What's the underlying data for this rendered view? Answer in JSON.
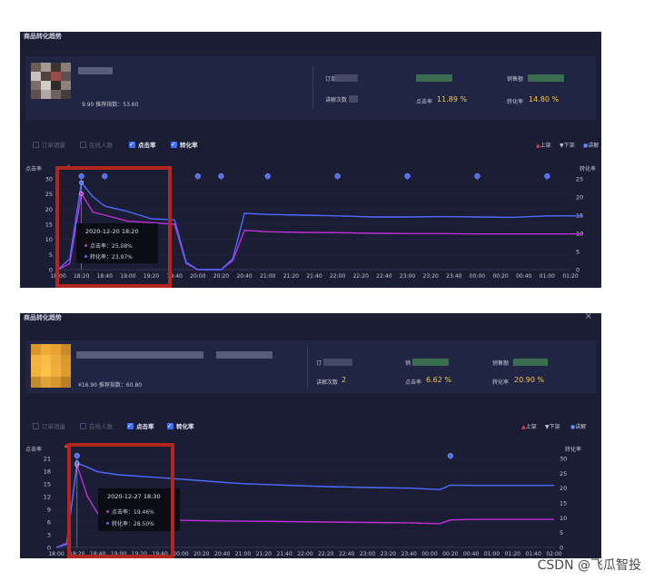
{
  "panel1": {
    "title": "商品转化趋势",
    "product": {
      "price_line": "9.90  推荐指数：53.60",
      "thumb_colors": [
        "#6b5b55",
        "#a89a92",
        "#3b3431",
        "#8b7d76",
        "#c9c0bb",
        "#4d4240",
        "#9b4b45",
        "#5b5150",
        "#7a6d69",
        "#d2cbc7",
        "#2f2a29",
        "#8e817c",
        "#5c504d",
        "#b0a7a2",
        "#6d625f",
        "#463d3b"
      ]
    },
    "stats": {
      "order_label": "订单",
      "explain_label": "讲解次数",
      "sales_label": "销售额",
      "click_label": "点击率",
      "click_value": "11.89 %",
      "conv_label": "转化率",
      "conv_value": "14.80 %"
    },
    "checkboxes": [
      {
        "label": "订单销量",
        "checked": false
      },
      {
        "label": "在线人数",
        "checked": false
      },
      {
        "label": "点击率",
        "checked": true
      },
      {
        "label": "转化率",
        "checked": true
      }
    ],
    "legend": {
      "up": "上架",
      "down": "下架",
      "explain": "讲解"
    },
    "left_axis_title": "点击率",
    "right_axis_title": "转化率",
    "tooltip": {
      "time": "2020-12-20 18:20",
      "click": "点击率：25.08%",
      "conv": "转化率：23.97%"
    }
  },
  "panel2": {
    "title": "商品转化趋势",
    "close": "×",
    "product": {
      "price_line": "¥16.90  推荐指数：60.80",
      "thumb_colors": [
        "#d9962d",
        "#f0ab36",
        "#e8a234",
        "#c98a2a",
        "#f6b340",
        "#f9bd45",
        "#eeac3b",
        "#d9982f",
        "#f3b13e",
        "#fbc24a",
        "#f0ae3c",
        "#dd9b31",
        "#c48a2c",
        "#e0a035",
        "#d6972f",
        "#b97f27"
      ]
    },
    "stats": {
      "order_label": "订",
      "sales_short_label": "销",
      "sales_label": "销售额",
      "explain_label": "讲解次数",
      "explain_value": "2",
      "click_label": "点击率",
      "click_value": "6.62 %",
      "conv_label": "转化率",
      "conv_value": "20.90 %"
    },
    "checkboxes": [
      {
        "label": "订单销量",
        "checked": false
      },
      {
        "label": "在线人数",
        "checked": false
      },
      {
        "label": "点击率",
        "checked": true
      },
      {
        "label": "转化率",
        "checked": true
      }
    ],
    "legend": {
      "up": "上架",
      "down": "下架",
      "explain": "讲解"
    },
    "left_axis_title": "点击率",
    "right_axis_title": "转化率",
    "tooltip": {
      "time": "2020-12-27 18:30",
      "click": "点击率：19.46%",
      "conv": "转化率：28.50%"
    }
  },
  "watermark": "CSDN @飞瓜智投",
  "colors": {
    "panel_bg": "#1a1d33",
    "card_bg": "#212544",
    "accent_blue": "#3f6ef0",
    "click_line": "#c030d8",
    "conv_line": "#4c6cff",
    "highlight": "#f2c94c",
    "annotation": "#b3261e"
  },
  "chart_data": [
    {
      "type": "line",
      "left_axis": {
        "title": "点击率",
        "ticks": [
          0,
          5,
          10,
          15,
          20,
          25,
          30
        ],
        "ylim": [
          0,
          30
        ]
      },
      "right_axis": {
        "title": "转化率",
        "ticks": [
          0,
          5,
          10,
          15,
          20,
          25
        ],
        "ylim": [
          0,
          25
        ]
      },
      "x_ticks": [
        "18:00",
        "18:20",
        "18:40",
        "19:00",
        "19:20",
        "19:40",
        "20:00",
        "20:20",
        "20:40",
        "21:00",
        "21:20",
        "21:40",
        "22:00",
        "22:20",
        "22:40",
        "23:00",
        "23:20",
        "23:40",
        "00:00",
        "00:20",
        "00:40",
        "01:00",
        "01:20"
      ],
      "series": [
        {
          "name": "点击率",
          "color": "#c030d8",
          "axis": "left",
          "x": [
            "18:00",
            "18:10",
            "18:20",
            "18:30",
            "18:40",
            "19:00",
            "19:20",
            "19:40",
            "19:50",
            "20:00",
            "20:20",
            "20:30",
            "20:40",
            "21:00",
            "21:30",
            "22:00",
            "22:30",
            "23:00",
            "23:30",
            "00:00",
            "00:30",
            "01:00",
            "01:30"
          ],
          "y": [
            0,
            2,
            25.1,
            19,
            18,
            16,
            15.5,
            15,
            2,
            0,
            0,
            3,
            13,
            12.5,
            12.3,
            12.2,
            12,
            11.9,
            11.9,
            11.8,
            11.8,
            11.8,
            11.8
          ]
        },
        {
          "name": "转化率",
          "color": "#4c6cff",
          "axis": "right",
          "x": [
            "18:00",
            "18:10",
            "18:20",
            "18:30",
            "18:40",
            "19:00",
            "19:20",
            "19:40",
            "19:50",
            "20:00",
            "20:20",
            "20:30",
            "20:40",
            "21:00",
            "21:30",
            "22:00",
            "22:30",
            "23:00",
            "23:30",
            "00:00",
            "00:30",
            "01:00",
            "01:30"
          ],
          "y": [
            0,
            3,
            23.97,
            20,
            17.5,
            16,
            14,
            13.7,
            2,
            0,
            0,
            3,
            15.5,
            15.2,
            15,
            14.8,
            14.5,
            14.5,
            14.6,
            14.5,
            14.4,
            14.8,
            14.8
          ]
        }
      ],
      "markers": {
        "up_at": [
          "18:20"
        ],
        "explain_at": [
          "18:20",
          "18:40",
          "20:00",
          "20:20",
          "21:00",
          "22:00",
          "23:00",
          "00:00",
          "01:00"
        ]
      },
      "highlight_range": [
        "18:00",
        "20:00"
      ],
      "grid": true
    },
    {
      "type": "line",
      "left_axis": {
        "title": "点击率",
        "ticks": [
          0,
          3,
          6,
          9,
          12,
          15,
          18,
          21
        ],
        "ylim": [
          0,
          21
        ]
      },
      "right_axis": {
        "title": "转化率",
        "ticks": [
          0,
          5,
          10,
          15,
          20,
          25,
          30
        ],
        "ylim": [
          0,
          30
        ]
      },
      "x_ticks": [
        "18:00",
        "18:20",
        "18:40",
        "19:00",
        "19:20",
        "19:40",
        "20:00",
        "20:20",
        "20:40",
        "21:00",
        "21:20",
        "21:40",
        "22:00",
        "22:20",
        "22:40",
        "23:00",
        "23:20",
        "23:40",
        "00:00",
        "00:20",
        "00:40",
        "01:00",
        "01:20",
        "01:40",
        "02:00"
      ],
      "series": [
        {
          "name": "点击率",
          "color": "#c030d8",
          "axis": "left",
          "x": [
            "18:00",
            "18:10",
            "18:20",
            "18:30",
            "18:40",
            "19:00",
            "19:40",
            "20:20",
            "21:00",
            "21:40",
            "22:20",
            "23:00",
            "23:40",
            "00:10",
            "00:20",
            "00:40",
            "01:20",
            "02:00"
          ],
          "y": [
            0,
            1,
            19.46,
            12,
            8,
            7,
            6.5,
            6.3,
            6.2,
            6.1,
            6.0,
            5.9,
            5.8,
            5.6,
            6.5,
            6.6,
            6.6,
            6.6
          ]
        },
        {
          "name": "转化率",
          "color": "#4c6cff",
          "axis": "right",
          "x": [
            "18:00",
            "18:10",
            "18:20",
            "18:30",
            "18:40",
            "19:00",
            "19:40",
            "20:20",
            "21:00",
            "21:40",
            "22:20",
            "23:00",
            "23:40",
            "00:10",
            "00:20",
            "00:40",
            "01:20",
            "02:00"
          ],
          "y": [
            0,
            1,
            28.5,
            27,
            25.5,
            24.5,
            23.5,
            22.5,
            21.5,
            21,
            20.5,
            20.2,
            20,
            19.5,
            21,
            20.9,
            20.9,
            20.9
          ]
        }
      ],
      "markers": {
        "up_at": [
          "18:20"
        ],
        "explain_at": [
          "18:20",
          "00:20"
        ]
      },
      "highlight_range": [
        "18:10",
        "19:40"
      ],
      "grid": true
    }
  ]
}
